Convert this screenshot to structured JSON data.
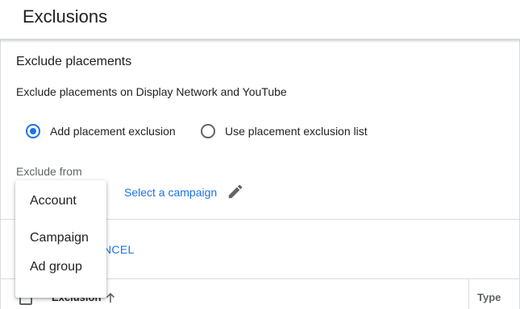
{
  "header": {
    "title": "Exclusions"
  },
  "section": {
    "title": "Exclude placements",
    "description": "Exclude placements on Display Network and YouTube"
  },
  "radios": [
    {
      "label": "Add placement exclusion",
      "checked": true
    },
    {
      "label": "Use placement exclusion list",
      "checked": false
    }
  ],
  "exclude_from": {
    "label": "Exclude from",
    "select_campaign": "Select a campaign",
    "edit_icon": "pencil-icon"
  },
  "actions": {
    "cancel": "NCEL"
  },
  "table": {
    "columns": [
      "Exclusion",
      "Type"
    ],
    "sort_icon": "arrow-up-icon"
  },
  "dropdown": {
    "options": [
      "Account",
      "Campaign",
      "Ad group"
    ]
  },
  "colors": {
    "accent": "#1a73e8",
    "text": "#202124",
    "muted": "#5f6368",
    "divider": "#dadce0"
  }
}
